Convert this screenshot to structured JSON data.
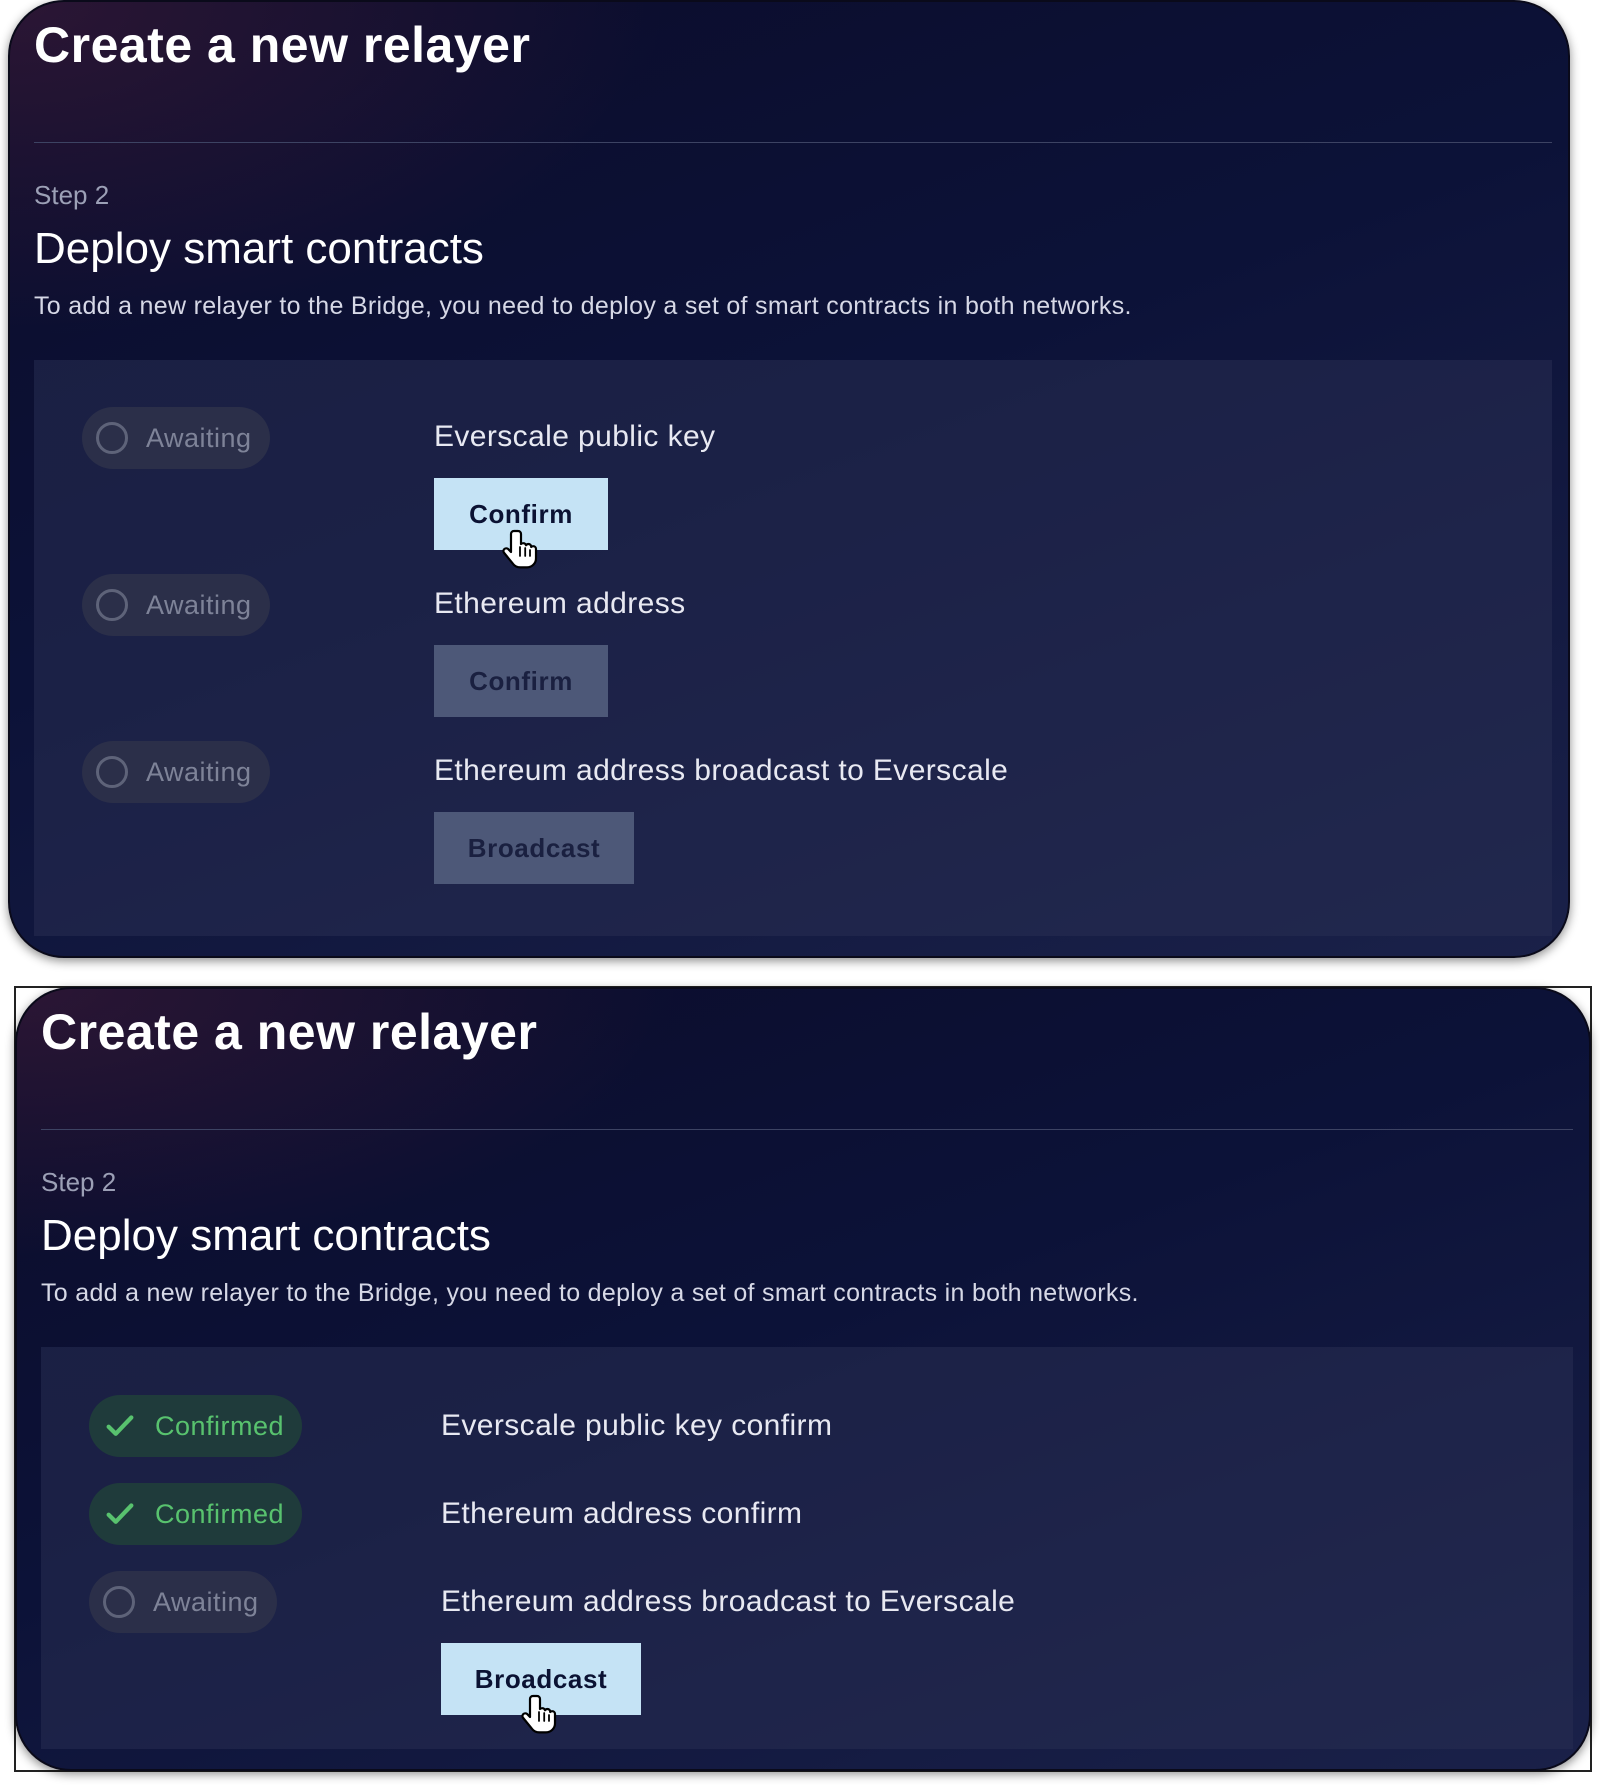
{
  "panels": [
    {
      "title": "Create a new relayer",
      "step_label": "Step 2",
      "section_title": "Deploy smart contracts",
      "description": "To add a new relayer to the Bridge, you need to deploy a set of smart contracts in both networks.",
      "steps": [
        {
          "status": "Awaiting",
          "label": "Everscale public key",
          "button": "Confirm",
          "button_state": "active"
        },
        {
          "status": "Awaiting",
          "label": "Ethereum address",
          "button": "Confirm",
          "button_state": "disabled"
        },
        {
          "status": "Awaiting",
          "label": "Ethereum address broadcast to Everscale",
          "button": "Broadcast",
          "button_state": "disabled"
        }
      ]
    },
    {
      "title": "Create a new relayer",
      "step_label": "Step 2",
      "section_title": "Deploy smart contracts",
      "description": "To add a new relayer to the Bridge, you need to deploy a set of smart contracts in both networks.",
      "steps": [
        {
          "status": "Confirmed",
          "label": "Everscale public key confirm"
        },
        {
          "status": "Confirmed",
          "label": "Ethereum address confirm"
        },
        {
          "status": "Awaiting",
          "label": "Ethereum address broadcast to Everscale",
          "button": "Broadcast",
          "button_state": "active"
        }
      ]
    }
  ],
  "icons": {
    "awaiting": "ring-icon",
    "confirmed": "checkmark-icon",
    "cursor": "hand-pointer-icon"
  },
  "colors": {
    "confirmed_green": "#58c26e",
    "active_button": "#c5e3f5",
    "disabled_button": "#4d5878"
  }
}
